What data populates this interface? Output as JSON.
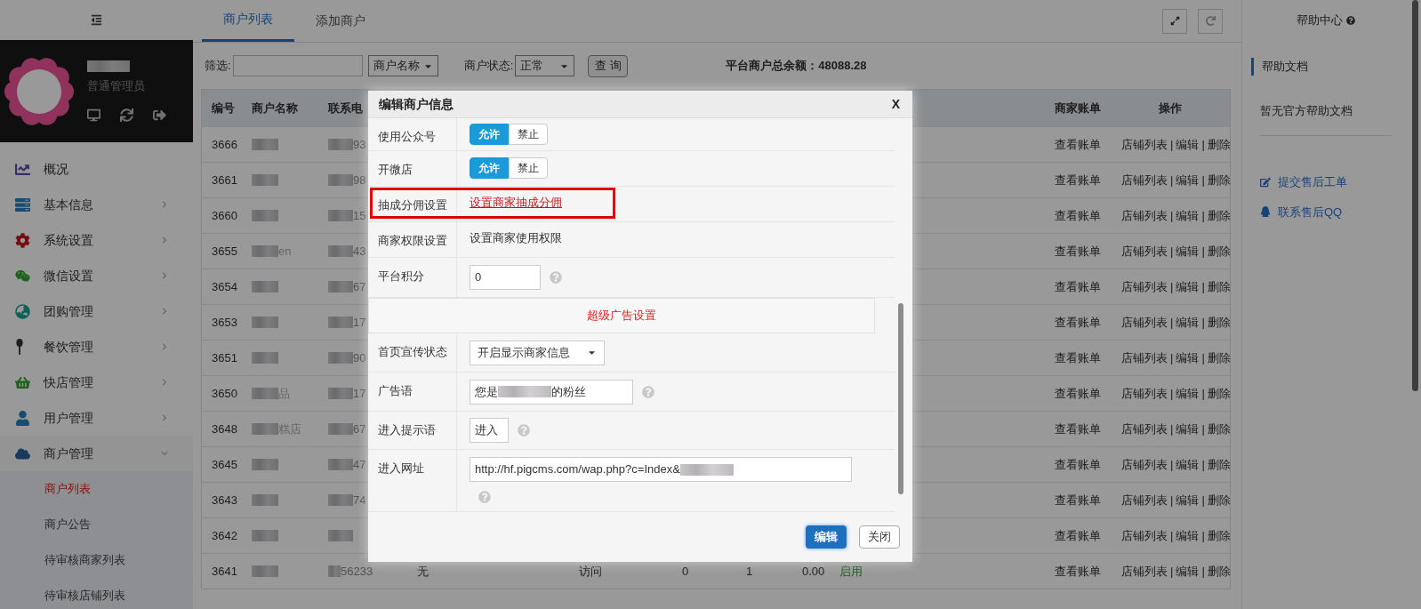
{
  "sidebar": {
    "role": "普通管理员",
    "menu": [
      {
        "label": "概况",
        "kind": "link"
      },
      {
        "label": "基本信息",
        "kind": "group",
        "expanded": false
      },
      {
        "label": "系统设置",
        "kind": "group",
        "expanded": false
      },
      {
        "label": "微信设置",
        "kind": "group",
        "expanded": false
      },
      {
        "label": "团购管理",
        "kind": "group",
        "expanded": false
      },
      {
        "label": "餐饮管理",
        "kind": "group",
        "expanded": false
      },
      {
        "label": "快店管理",
        "kind": "group",
        "expanded": false
      },
      {
        "label": "用户管理",
        "kind": "group",
        "expanded": false
      },
      {
        "label": "商户管理",
        "kind": "group",
        "expanded": true,
        "children": [
          {
            "label": "商户列表",
            "selected": true
          },
          {
            "label": "商户公告",
            "selected": false
          },
          {
            "label": "待审核商家列表",
            "selected": false
          },
          {
            "label": "待审核店铺列表",
            "selected": false
          }
        ]
      }
    ]
  },
  "tabs": [
    {
      "label": "商户列表",
      "selected": true
    },
    {
      "label": "添加商户",
      "selected": false
    }
  ],
  "filter": {
    "label": "筛选:",
    "field_select": "商户名称",
    "status_label": "商户状态:",
    "status_select": "正常",
    "query_button": "查 询",
    "balance": "平台商户总余额：48088.28"
  },
  "table": {
    "columns": [
      "编号",
      "商户名称",
      "联系电",
      "商家账单",
      "操作"
    ],
    "rows": [
      {
        "id": "3666",
        "name_redacted": true,
        "phone": "93",
        "phone_redacted": true,
        "bill": "查看账单",
        "actions": [
          "店铺列表",
          "|",
          "编辑",
          "|",
          "删除"
        ]
      },
      {
        "id": "3661",
        "name_redacted": true,
        "phone": "98",
        "phone_redacted": true,
        "bill": "查看账单",
        "actions": [
          "店铺列表",
          "|",
          "编辑",
          "|",
          "删除"
        ]
      },
      {
        "id": "3660",
        "name_redacted": true,
        "phone": "15",
        "phone_redacted": true,
        "bill": "查看账单",
        "actions": [
          "店铺列表",
          "|",
          "编辑",
          "|",
          "删除"
        ]
      },
      {
        "id": "3655",
        "name_redacted": true,
        "name": "en",
        "phone": "43",
        "phone_redacted": true,
        "bill": "查看账单",
        "actions": [
          "店铺列表",
          "|",
          "编辑",
          "|",
          "删除"
        ]
      },
      {
        "id": "3654",
        "name_redacted": true,
        "phone": "67",
        "phone_redacted": true,
        "bill": "查看账单",
        "actions": [
          "店铺列表",
          "|",
          "编辑",
          "|",
          "删除"
        ]
      },
      {
        "id": "3653",
        "name_redacted": true,
        "phone": "17",
        "phone_redacted": true,
        "bill": "查看账单",
        "actions": [
          "店铺列表",
          "|",
          "编辑",
          "|",
          "删除"
        ]
      },
      {
        "id": "3651",
        "name_redacted": true,
        "phone": "90",
        "phone_redacted": true,
        "bill": "查看账单",
        "actions": [
          "店铺列表",
          "|",
          "编辑",
          "|",
          "删除"
        ]
      },
      {
        "id": "3650",
        "name_redacted": true,
        "name": "品",
        "phone": "17",
        "phone_redacted": true,
        "bill": "查看账单",
        "actions": [
          "店铺列表",
          "|",
          "编辑",
          "|",
          "删除"
        ]
      },
      {
        "id": "3648",
        "name_redacted": true,
        "name": "糕店",
        "phone": "67",
        "phone_redacted": true,
        "bill": "查看账单",
        "actions": [
          "店铺列表",
          "|",
          "编辑",
          "|",
          "删除"
        ]
      },
      {
        "id": "3645",
        "name_redacted": true,
        "phone": "47",
        "phone_redacted": true,
        "bill": "查看账单",
        "actions": [
          "店铺列表",
          "|",
          "编辑",
          "|",
          "删除"
        ]
      },
      {
        "id": "3643",
        "name_redacted": true,
        "phone": "74",
        "phone_redacted": true,
        "bill": "查看账单",
        "actions": [
          "店铺列表",
          "|",
          "编辑",
          "|",
          "删除"
        ]
      },
      {
        "id": "3642",
        "name_redacted": true,
        "phone_redacted": true,
        "bill": "查看账单",
        "actions": [
          "店铺列表",
          "|",
          "编辑",
          "|",
          "删除"
        ]
      },
      {
        "id": "3641",
        "name_redacted": true,
        "phone": "56233",
        "phone_redacted": true,
        "cells": [
          "无",
          "访问",
          "0",
          "1",
          "0.00"
        ],
        "status": "启用",
        "bill": "查看账单",
        "actions": [
          "店铺列表",
          "|",
          "编辑",
          "|",
          "删除"
        ]
      }
    ]
  },
  "help": {
    "title": "帮助中心",
    "doc_tab": "帮助文档",
    "empty_text": "暂无官方帮助文档",
    "links": [
      "提交售后工单",
      "联系售后QQ"
    ]
  },
  "modal": {
    "title": "编辑商户信息",
    "close_label": "X",
    "rows": [
      {
        "kind": "toggle",
        "label": "使用公众号",
        "options": [
          {
            "label": "允许",
            "selected": true
          },
          {
            "label": "禁止",
            "selected": false
          }
        ]
      },
      {
        "kind": "toggle",
        "label": "开微店",
        "options": [
          {
            "label": "允许",
            "selected": true
          },
          {
            "label": "禁止",
            "selected": false
          }
        ]
      },
      {
        "kind": "link",
        "label": "抽成分佣设置",
        "text": "设置商家抽成分佣",
        "highlighted": true
      },
      {
        "kind": "text",
        "label": "商家权限设置",
        "text": "设置商家使用权限"
      },
      {
        "kind": "input",
        "label": "平台积分",
        "value": "0",
        "help": true
      },
      {
        "kind": "section",
        "text": "超级广告设置"
      },
      {
        "kind": "select",
        "label": "首页宣传状态",
        "value": "开启显示商家信息"
      },
      {
        "kind": "input",
        "label": "广告语",
        "value": "您是",
        "value_redacted": true,
        "value_after": "的粉丝",
        "help": true
      },
      {
        "kind": "input",
        "label": "进入提示语",
        "value": "进入",
        "help": true
      },
      {
        "kind": "input",
        "label": "进入网址",
        "value": "http://hf.pigcms.com/wap.php?c=Index&",
        "value_redacted": true,
        "help": true,
        "help_below": true
      }
    ],
    "buttons": [
      {
        "label": "编辑",
        "kind": "primary"
      },
      {
        "label": "关闭",
        "kind": "default"
      }
    ]
  }
}
